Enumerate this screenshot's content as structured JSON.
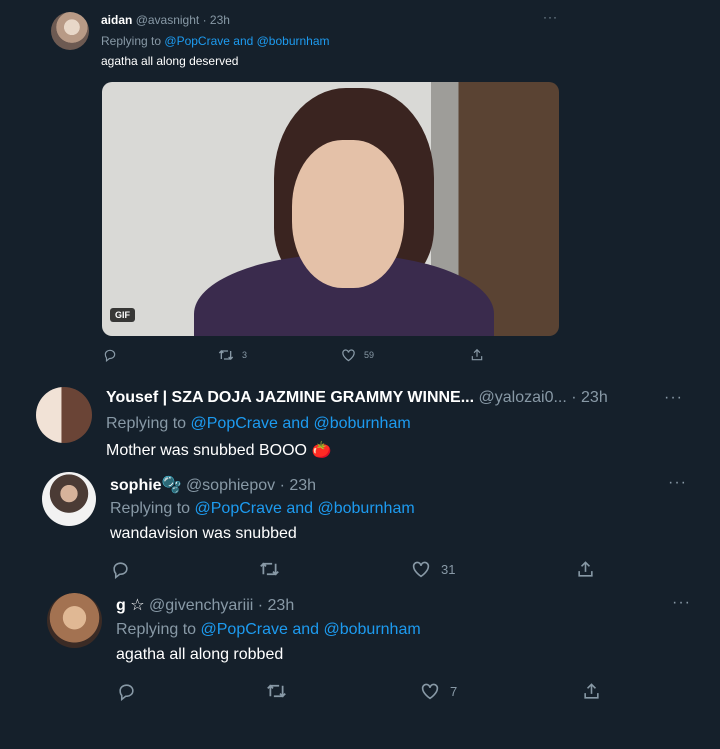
{
  "tweets": [
    {
      "name": "aidan",
      "handle": "@avasnight · 23h",
      "replying_prefix": "Replying to",
      "replying_links": "@PopCrave and @boburnham",
      "text": "agatha all along deserved",
      "media_badge": "GIF",
      "actions": {
        "retweets": "3",
        "likes": "59"
      }
    },
    {
      "name": "Yousef | SZA DOJA JAZMINE GRAMMY WINNE...",
      "handle": "@yalozai0... · 23h",
      "replying_prefix": "Replying to",
      "replying_links": "@PopCrave and @boburnham",
      "text": "Mother was snubbed BOOO",
      "emoji": "🍅"
    },
    {
      "name": "sophie",
      "name_emoji": "🫧",
      "handle": "@sophiepov · 23h",
      "replying_prefix": "Replying to",
      "replying_links": "@PopCrave and @boburnham",
      "text": "wandavision was snubbed",
      "actions": {
        "likes": "31"
      }
    },
    {
      "name": "g ☆",
      "handle": "@givenchyariii · 23h",
      "replying_prefix": "Replying to",
      "replying_links": "@PopCrave and @boburnham",
      "text": "agatha all along robbed",
      "actions": {
        "likes": "7"
      }
    }
  ],
  "icons": {
    "reply": "reply-icon",
    "retweet": "retweet-icon",
    "like": "heart-icon",
    "share": "share-icon",
    "more": "more-icon"
  },
  "colors": {
    "background": "#15202b",
    "link": "#1d9bf0",
    "muted": "#8899a6",
    "text": "#ffffff"
  }
}
